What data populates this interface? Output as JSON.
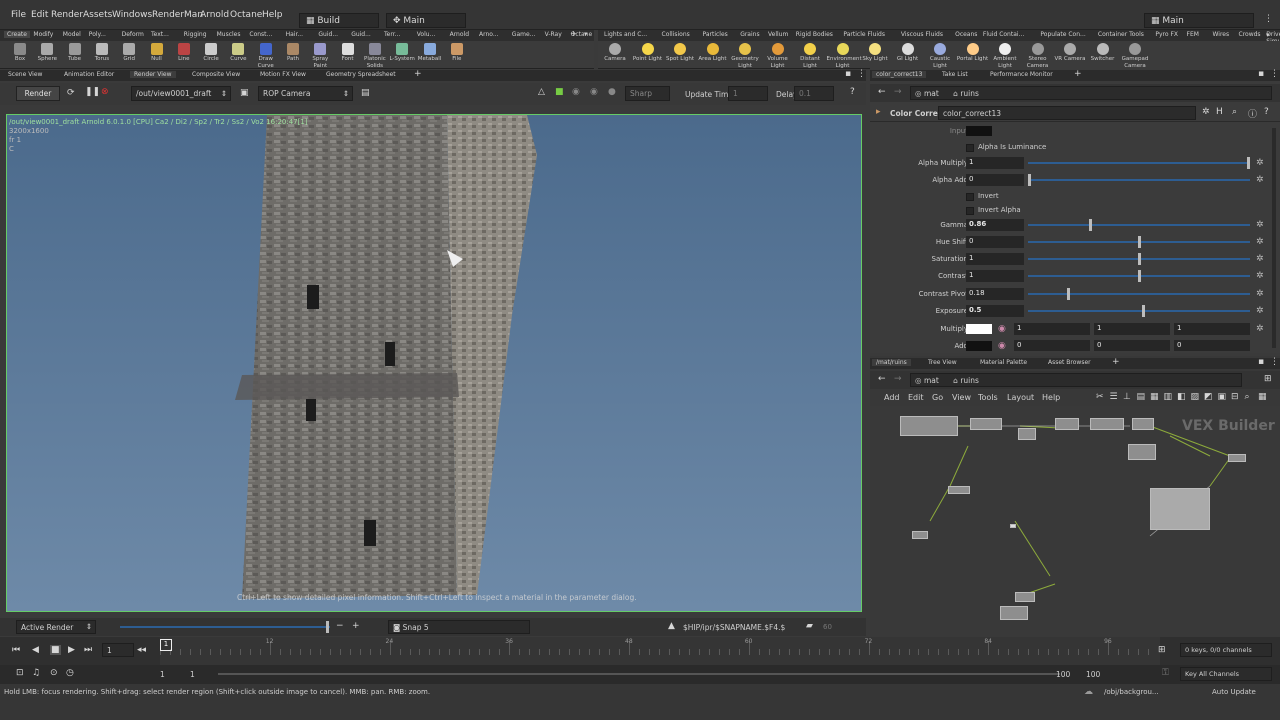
{
  "menubar": {
    "items": [
      "File",
      "Edit",
      "Render",
      "Assets",
      "Windows",
      "RenderMan",
      "Arnold",
      "Octane",
      "Help"
    ],
    "desktop": "Build",
    "desk_main": "Main",
    "right_desktop": "Main"
  },
  "shelf_left": {
    "tabs": [
      "Create",
      "Modify",
      "Model",
      "Poly...",
      "Deform",
      "Text...",
      "Rigging",
      "Muscles",
      "Const...",
      "Hair...",
      "Guid...",
      "Guid...",
      "Terr...",
      "Volu...",
      "Arnold",
      "Arno...",
      "Game...",
      "V-Ray",
      "Octane"
    ],
    "tools": [
      "Box",
      "Sphere",
      "Tube",
      "Torus",
      "Grid",
      "Null",
      "Line",
      "Circle",
      "Curve",
      "Draw Curve",
      "Path",
      "Spray Paint",
      "Font",
      "Platonic Solids",
      "L-System",
      "Metaball",
      "File"
    ]
  },
  "shelf_right": {
    "tabs": [
      "Lights and C...",
      "Collisions",
      "Particles",
      "Grains",
      "Vellum",
      "Rigid Bodies",
      "Particle Fluids",
      "Viscous Fluids",
      "Oceans",
      "Fluid Contai...",
      "Populate Con...",
      "Container Tools",
      "Pyro FX",
      "FEM",
      "Wires",
      "Crowds",
      "Drive Simula..."
    ],
    "tools": [
      "Camera",
      "Point Light",
      "Spot Light",
      "Area Light",
      "Geometry Light",
      "Volume Light",
      "Distant Light",
      "Environment Light",
      "Sky Light",
      "GI Light",
      "Caustic Light",
      "Portal Light",
      "Ambient Light",
      "Stereo Camera",
      "VR Camera",
      "Switcher",
      "Gamepad Camera"
    ]
  },
  "pane_tabs_left": [
    "Scene View",
    "Animation Editor",
    "Render View",
    "Composite View",
    "Motion FX View",
    "Geometry Spreadsheet"
  ],
  "render_bar": {
    "render_label": "Render",
    "output_path": "/out/view0001_draft",
    "camera": "ROP Camera",
    "sharp_label": "Sharp",
    "update_time_label": "Update Time",
    "update_time_value": "1",
    "delay_label": "Delay",
    "delay_value": "0.1"
  },
  "viewport": {
    "info_line1": "/out/view0001_draft   Arnold 6.0.1.0 [CPU] Ca2 / Di2 / Sp2 / Tr2 / Ss2 / Vo2  16:20:47[1]",
    "info_line2": "3200x1600",
    "info_line3": "fr 1",
    "info_line4": "C",
    "hint": "Ctrl+Left to show detailed pixel information. Shift+Ctrl+Left to inspect a material in the parameter dialog."
  },
  "view_status": {
    "active_render": "Active Render",
    "snap": "Snap 5",
    "snap_path": "$HIP/ipr/$SNAPNAME.$F4.$",
    "snap_count": "60"
  },
  "timeline": {
    "frame": "1",
    "start": "1",
    "start2": "1",
    "end": "100",
    "end2": "100",
    "ticks": [
      "12",
      "24",
      "36",
      "48",
      "60",
      "72",
      "84",
      "96"
    ],
    "keys": "0 keys, 0/0 channels",
    "key_all": "Key All Channels"
  },
  "statusbar": {
    "message": "Hold LMB: focus rendering. Shift+drag: select render region (Shift+click outside image to cancel). MMB: pan. RMB: zoom.",
    "obj_path": "/obj/backgrou...",
    "auto_update": "Auto Update"
  },
  "param_pane": {
    "tabs": [
      "color_correct13",
      "Take List",
      "Performance Monitor"
    ],
    "path_context": "mat",
    "path_node": "ruins",
    "node_type": "Color Correct",
    "node_name": "color_correct13",
    "input_label": "Input",
    "alpha_is_lum": "Alpha Is Luminance",
    "invert": "Invert",
    "invert_alpha": "Invert Alpha",
    "multiply_label": "Multiply",
    "add_label": "Add",
    "multiply_values": [
      "1",
      "1",
      "1"
    ],
    "add_values": [
      "0",
      "0",
      "0"
    ],
    "params": [
      {
        "label": "Alpha Multiply",
        "value": "1",
        "fraction": 1.0
      },
      {
        "label": "Alpha Add",
        "value": "0",
        "fraction": 0.0
      },
      {
        "label": "Gamma",
        "value": "0.86",
        "fraction": 0.28
      },
      {
        "label": "Hue Shift",
        "value": "0",
        "fraction": 0.5
      },
      {
        "label": "Saturation",
        "value": "1",
        "fraction": 0.5
      },
      {
        "label": "Contrast",
        "value": "1",
        "fraction": 0.5
      },
      {
        "label": "Contrast Pivot",
        "value": "0.18",
        "fraction": 0.18
      },
      {
        "label": "Exposure",
        "value": "0.5",
        "fraction": 0.52
      }
    ]
  },
  "network_pane": {
    "tabs": [
      "/mat/ruins",
      "Tree View",
      "Material Palette",
      "Asset Browser"
    ],
    "path_context": "mat",
    "path_node": "ruins",
    "menu": [
      "Add",
      "Edit",
      "Go",
      "View",
      "Tools",
      "Layout",
      "Help"
    ],
    "watermark": "VEX Builder"
  },
  "colors": {
    "accent_blue": "#2d5d92",
    "render_border": "#66cc66",
    "stop_red": "#cc3333"
  }
}
